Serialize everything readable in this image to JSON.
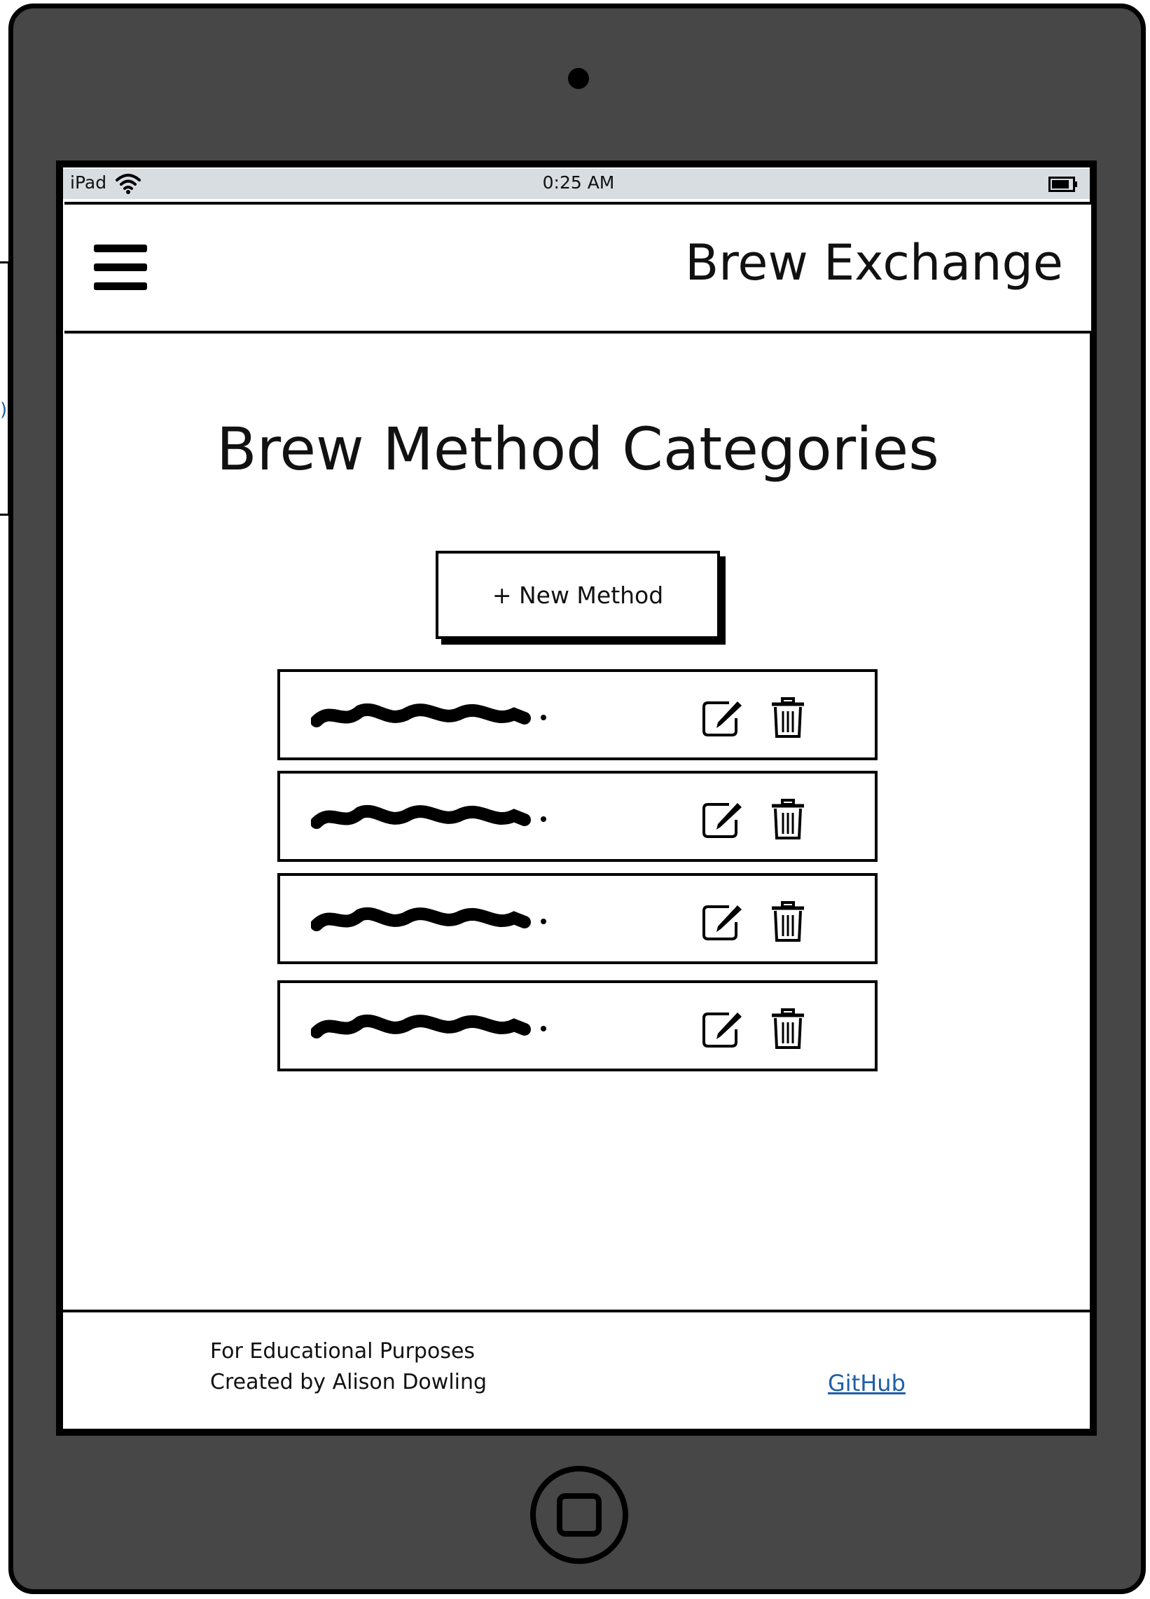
{
  "status_bar": {
    "device": "iPad",
    "time": "0:25 AM"
  },
  "header": {
    "app_title": "Brew Exchange"
  },
  "page": {
    "title": "Brew Method Categories",
    "new_button_label": "+ New Method"
  },
  "method_list": {
    "item_count": 4
  },
  "footer": {
    "line1": "For Educational Purposes",
    "line2": "Created by Alison Dowling",
    "link_label": "GitHub"
  },
  "icons": {
    "menu": "hamburger-menu-icon",
    "edit": "edit-icon",
    "delete": "trash-icon",
    "wifi": "wifi-icon",
    "battery": "battery-icon"
  },
  "colors": {
    "frame": "#474747",
    "status_bar": "#d7dde0",
    "link": "#1f5fa8"
  }
}
